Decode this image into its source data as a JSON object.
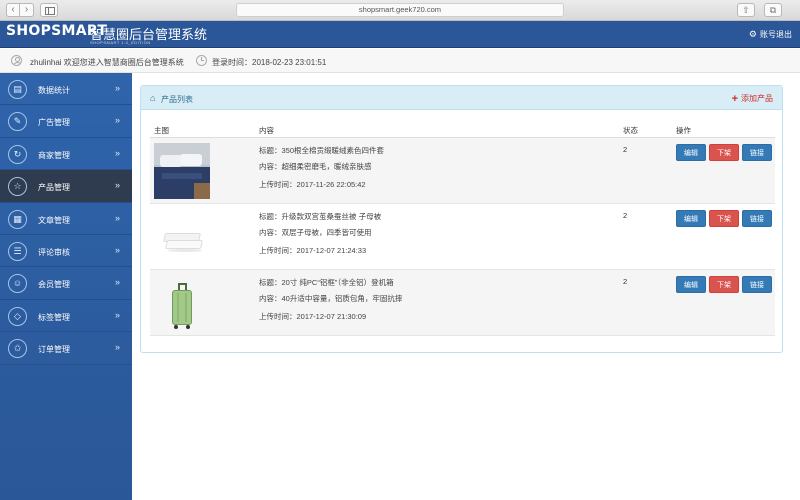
{
  "browser": {
    "url": "shopsmart.geek720.com"
  },
  "header": {
    "logo": "SHOPSMART",
    "logo_sub": "SHOPSMART 1.0_EDITION",
    "title": "智慧圈后台管理系统",
    "logout": "账号退出"
  },
  "userbar": {
    "welcome": "zhulinhai 欢迎您进入智慧商圈后台管理系统",
    "login_time": "登录时间：2018-02-23 23:01:51"
  },
  "sidebar": {
    "items": [
      {
        "label": "数据统计",
        "icon": "chart-icon",
        "active": false
      },
      {
        "label": "广告管理",
        "icon": "ad-icon",
        "active": false
      },
      {
        "label": "商家管理",
        "icon": "merchant-icon",
        "active": false
      },
      {
        "label": "产品管理",
        "icon": "product-icon",
        "active": true
      },
      {
        "label": "文章管理",
        "icon": "article-icon",
        "active": false
      },
      {
        "label": "评论审核",
        "icon": "comment-icon",
        "active": false
      },
      {
        "label": "会员管理",
        "icon": "member-icon",
        "active": false
      },
      {
        "label": "标签管理",
        "icon": "tag-icon",
        "active": false
      },
      {
        "label": "订单管理",
        "icon": "order-icon",
        "active": false
      }
    ],
    "chevron": "»"
  },
  "panel": {
    "title": "产品列表",
    "add_label": "添加产品",
    "columns": {
      "image": "主图",
      "content": "内容",
      "status": "状态",
      "actions": "操作"
    },
    "buttons": {
      "edit": "编辑",
      "offline": "下架",
      "link": "链接"
    },
    "rows": [
      {
        "title": "标题：350根全棉贡缎暖绒素色四件套",
        "content": "内容：超细柔密磨毛，暖绒亲肤感",
        "upload_time": "上传时间：2017-11-26 22:05:42",
        "status": "2",
        "image": "bedding-set"
      },
      {
        "title": "标题：升级款双宫茧桑蚕丝被 子母被",
        "content": "内容：双层子母被，四季皆可使用",
        "upload_time": "上传时间：2017-12-07 21:24:33",
        "status": "2",
        "image": "silk-quilt"
      },
      {
        "title": "标题：20寸 纯PC“铝框”（非全铝）登机箱",
        "content": "内容：40升适中容量，铝质包角，牢固抗摔",
        "upload_time": "上传时间：2017-12-07 21:30:09",
        "status": "2",
        "image": "green-luggage"
      }
    ]
  },
  "colors": {
    "header_bg": "#2b5697",
    "sidebar_bg": "#2f64ab",
    "sidebar_active": "#2f3b4f",
    "panel_head_bg": "#d9edf7",
    "primary": "#337ab7",
    "danger": "#d9534f"
  }
}
